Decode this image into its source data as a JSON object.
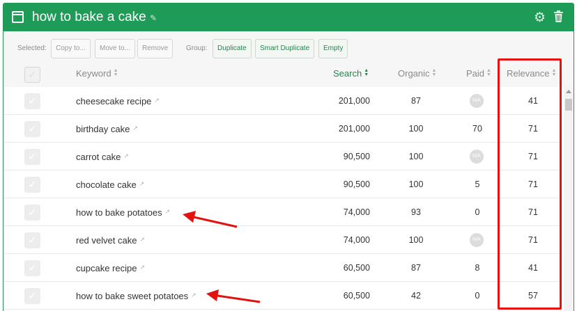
{
  "header": {
    "title": "how to bake a cake",
    "pencil_icon": "pencil-icon",
    "gear_icon": "gear-icon",
    "trash_icon": "trash-icon"
  },
  "toolbar": {
    "selected_label": "Selected:",
    "copy_label": "Copy to...",
    "move_label": "Move to...",
    "remove_label": "Remove",
    "group_label": "Group:",
    "duplicate_label": "Duplicate",
    "smart_duplicate_label": "Smart Duplicate",
    "empty_label": "Empty"
  },
  "table": {
    "columns": {
      "keyword": "Keyword",
      "search": "Search",
      "organic": "Organic",
      "paid": "Paid",
      "relevance": "Relevance"
    },
    "na_label": "N/A",
    "rows": [
      {
        "keyword": "cheesecake recipe",
        "search": "201,000",
        "organic": "87",
        "paid": "N/A",
        "relevance": "41"
      },
      {
        "keyword": "birthday cake",
        "search": "201,000",
        "organic": "100",
        "paid": "70",
        "relevance": "71"
      },
      {
        "keyword": "carrot cake",
        "search": "90,500",
        "organic": "100",
        "paid": "N/A",
        "relevance": "71"
      },
      {
        "keyword": "chocolate cake",
        "search": "90,500",
        "organic": "100",
        "paid": "5",
        "relevance": "71"
      },
      {
        "keyword": "how to bake potatoes",
        "search": "74,000",
        "organic": "93",
        "paid": "0",
        "relevance": "71"
      },
      {
        "keyword": "red velvet cake",
        "search": "74,000",
        "organic": "100",
        "paid": "N/A",
        "relevance": "71"
      },
      {
        "keyword": "cupcake recipe",
        "search": "60,500",
        "organic": "87",
        "paid": "8",
        "relevance": "41"
      },
      {
        "keyword": "how to bake sweet potatoes",
        "search": "60,500",
        "organic": "42",
        "paid": "0",
        "relevance": "57"
      }
    ]
  },
  "colors": {
    "brand": "#1d9b57",
    "highlight": "#e3120f"
  }
}
